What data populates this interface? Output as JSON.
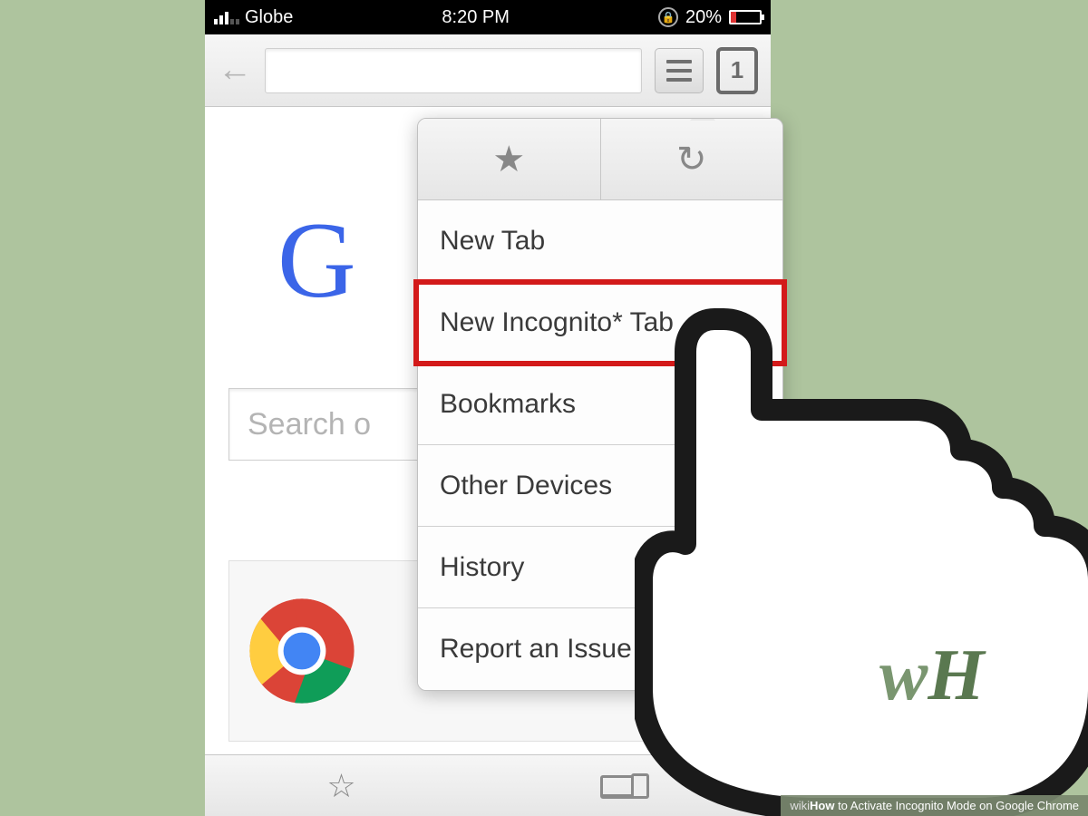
{
  "status": {
    "carrier": "Globe",
    "time": "8:20 PM",
    "battery_pct": "20%"
  },
  "browser": {
    "tab_count": "1",
    "search_placeholder": "Search o"
  },
  "menu": {
    "items": [
      "New Tab",
      "New Incognito* Tab",
      "Bookmarks",
      "Other Devices",
      "History",
      "Report an Issue"
    ]
  },
  "google_partial": "G",
  "caption": {
    "prefix": "wiki",
    "how": "How",
    "rest": " to Activate Incognito Mode on Google Chrome"
  },
  "hand_logo": {
    "w": "w",
    "h": "H"
  }
}
